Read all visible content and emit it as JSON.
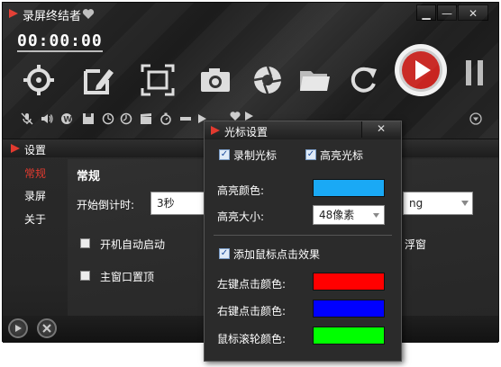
{
  "main_window": {
    "title": "录屏终结者",
    "timer": "00:00:00",
    "window_buttons": [
      "▁",
      "—",
      "✕"
    ]
  },
  "settings_window": {
    "title": "设置",
    "nav": [
      "常规",
      "录屏",
      "关于"
    ],
    "section_title": "常规",
    "countdown_label": "开始倒计时:",
    "countdown_value": "3秒",
    "right_combo_value": "ng",
    "autostart_label": "开机自动启动",
    "topmost_label": "主窗口置顶",
    "float_label": "浮窗"
  },
  "cursor_dialog": {
    "title": "光标设置",
    "close": "✕",
    "record_cursor_label": "录制光标",
    "highlight_cursor_label": "高亮光标",
    "highlight_color_label": "高亮颜色:",
    "highlight_size_label": "高亮大小:",
    "highlight_size_value": "48像素",
    "click_effect_label": "添加鼠标点击效果",
    "left_click_label": "左键点击颜色:",
    "right_click_label": "右键点击颜色:",
    "wheel_label": "鼠标滚轮颜色:",
    "colors": {
      "highlight": "#1aa9f5",
      "left_click": "#ff0000",
      "right_click": "#0000ff",
      "wheel": "#00ff00"
    }
  },
  "icons": {
    "toolbar": [
      "crosshair-icon",
      "edit-icon",
      "fullscreen-region-icon",
      "camera-icon",
      "aperture-icon",
      "folder-icon",
      "refresh-icon",
      "record-icon",
      "pause-icon"
    ],
    "small_row": [
      "mute-mic-icon",
      "speaker-icon",
      "wordpress-icon",
      "save-icon",
      "timer-icon",
      "clock-icon",
      "clapper-icon",
      "stopwatch-icon",
      "bar-icon",
      "play-small-icon",
      "heart-small-icon"
    ]
  }
}
